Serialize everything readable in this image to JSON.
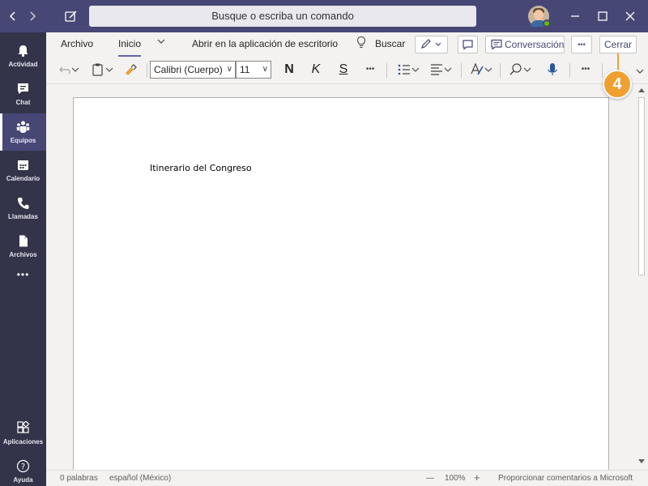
{
  "titlebar": {
    "search_placeholder": "Busque o escriba un comando"
  },
  "rail": {
    "items": [
      {
        "label": "Actividad",
        "icon": "bell-icon"
      },
      {
        "label": "Chat",
        "icon": "chat-icon"
      },
      {
        "label": "Equipos",
        "icon": "teams-icon"
      },
      {
        "label": "Calendario",
        "icon": "calendar-icon"
      },
      {
        "label": "Llamadas",
        "icon": "phone-icon"
      },
      {
        "label": "Archivos",
        "icon": "file-icon"
      }
    ],
    "more": "•••",
    "apps_label": "Aplicaciones",
    "help_label": "Ayuda"
  },
  "ribbon": {
    "tabs": {
      "archivo": "Archivo",
      "inicio": "Inicio",
      "open_desktop": "Abrir en la aplicación de escritorio",
      "buscar": "Buscar"
    },
    "conversation": "Conversación",
    "more": "•••",
    "close": "Cerrar",
    "font_name": "Calibri (Cuerpo)",
    "font_size": "11",
    "bold": "N",
    "italic": "K",
    "underline": "S"
  },
  "document": {
    "text": "Itinerario del Congreso"
  },
  "status": {
    "words": "0 palabras",
    "language": "español (México)",
    "zoom_minus": "—",
    "zoom": "100%",
    "zoom_plus": "+",
    "feedback": "Proporcionar comentarios a Microsoft"
  },
  "callout": {
    "number": "4",
    "color": "#f0a030"
  },
  "colors": {
    "titlebar": "#464775",
    "rail": "#33344a",
    "accent": "#6264a7"
  }
}
